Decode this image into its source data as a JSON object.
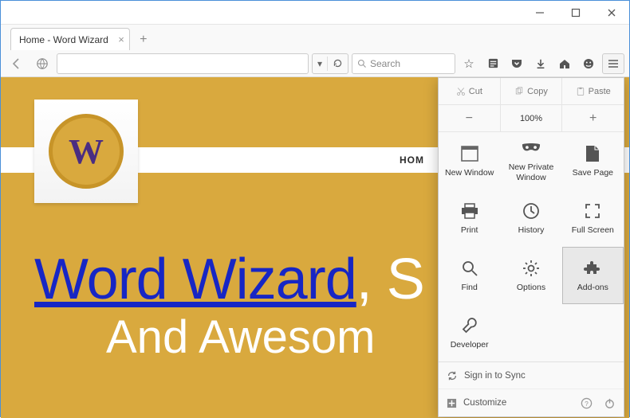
{
  "window": {
    "tab_title": "Home - Word Wizard"
  },
  "toolbar": {
    "search_placeholder": "Search"
  },
  "page": {
    "nav_home": "HOM",
    "logo_letter": "W",
    "hero_brand": "Word Wizard",
    "hero_comma_tail": ", S",
    "hero_line2": "And Awesom"
  },
  "menu": {
    "cut": "Cut",
    "copy": "Copy",
    "paste": "Paste",
    "zoom_out": "−",
    "zoom_level": "100%",
    "zoom_in": "+",
    "items": [
      {
        "label": "New Window"
      },
      {
        "label": "New Private\nWindow"
      },
      {
        "label": "Save Page"
      },
      {
        "label": "Print"
      },
      {
        "label": "History"
      },
      {
        "label": "Full Screen"
      },
      {
        "label": "Find"
      },
      {
        "label": "Options"
      },
      {
        "label": "Add-ons",
        "highlight": true
      },
      {
        "label": "Developer"
      }
    ],
    "sign_in": "Sign in to Sync",
    "customize": "Customize"
  }
}
